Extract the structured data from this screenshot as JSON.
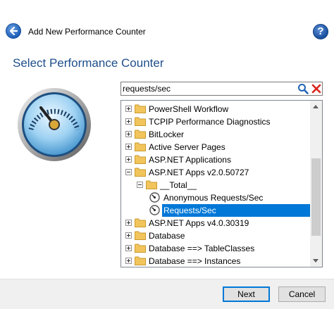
{
  "window": {
    "title": "Add New Performance Counter"
  },
  "heading": "Select Performance Counter",
  "search": {
    "value": "requests/sec"
  },
  "tree": {
    "items": [
      {
        "label": "PowerShell Workflow",
        "type": "folder",
        "expander": "plus",
        "level": 0
      },
      {
        "label": "TCPIP Performance Diagnostics",
        "type": "folder",
        "expander": "plus",
        "level": 0
      },
      {
        "label": "BitLocker",
        "type": "folder",
        "expander": "plus",
        "level": 0
      },
      {
        "label": "Active Server Pages",
        "type": "folder",
        "expander": "plus",
        "level": 0
      },
      {
        "label": "ASP.NET Applications",
        "type": "folder",
        "expander": "plus",
        "level": 0
      },
      {
        "label": "ASP.NET Apps v2.0.50727",
        "type": "folder",
        "expander": "minus",
        "level": 0
      },
      {
        "label": "__Total__",
        "type": "folder",
        "expander": "minus",
        "level": 1
      },
      {
        "label": "Anonymous Requests/Sec",
        "type": "counter",
        "expander": "none",
        "level": 2
      },
      {
        "label": "Requests/Sec",
        "type": "counter",
        "expander": "none",
        "level": 2,
        "selected": true
      },
      {
        "label": "ASP.NET Apps v4.0.30319",
        "type": "folder",
        "expander": "plus",
        "level": 0
      },
      {
        "label": "Database",
        "type": "folder",
        "expander": "plus",
        "level": 0
      },
      {
        "label": "Database ==> TableClasses",
        "type": "folder",
        "expander": "plus",
        "level": 0
      },
      {
        "label": "Database ==> Instances",
        "type": "folder",
        "expander": "plus",
        "level": 0
      }
    ]
  },
  "buttons": {
    "next_label": "Next",
    "cancel_label": "Cancel"
  },
  "colors": {
    "heading": "#1e4e8c",
    "selection": "#0078d7",
    "folder": "#f2c55c"
  },
  "icons": {
    "back": "back-arrow-icon",
    "help": "help-icon",
    "search": "search-icon",
    "clear": "clear-icon",
    "gauge": "gauge-icon"
  }
}
